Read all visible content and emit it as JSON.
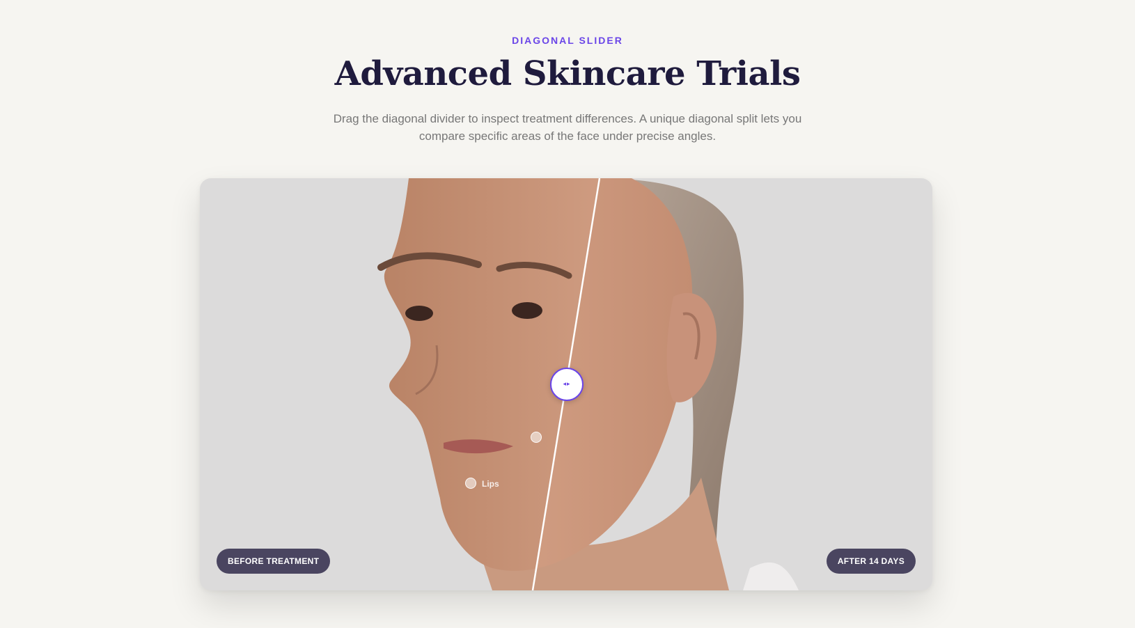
{
  "header": {
    "eyebrow": "DIAGONAL SLIDER",
    "title": "Advanced Skincare Trials",
    "subtitle": "Drag the diagonal divider to inspect treatment differences. A unique diagonal split lets you compare specific areas of the face under precise angles."
  },
  "slider": {
    "before_label": "BEFORE TREATMENT",
    "after_label": "AFTER 14 DAYS",
    "handle_icon": "horizontal-arrows-icon",
    "handle_glyph": "◂▸",
    "hotspots": [
      {
        "label": "Lips"
      },
      {
        "label": ""
      }
    ]
  },
  "colors": {
    "accent": "#6a45e8",
    "title": "#1f1b3d",
    "pill": "#4a4560",
    "background": "#f6f5f1"
  }
}
